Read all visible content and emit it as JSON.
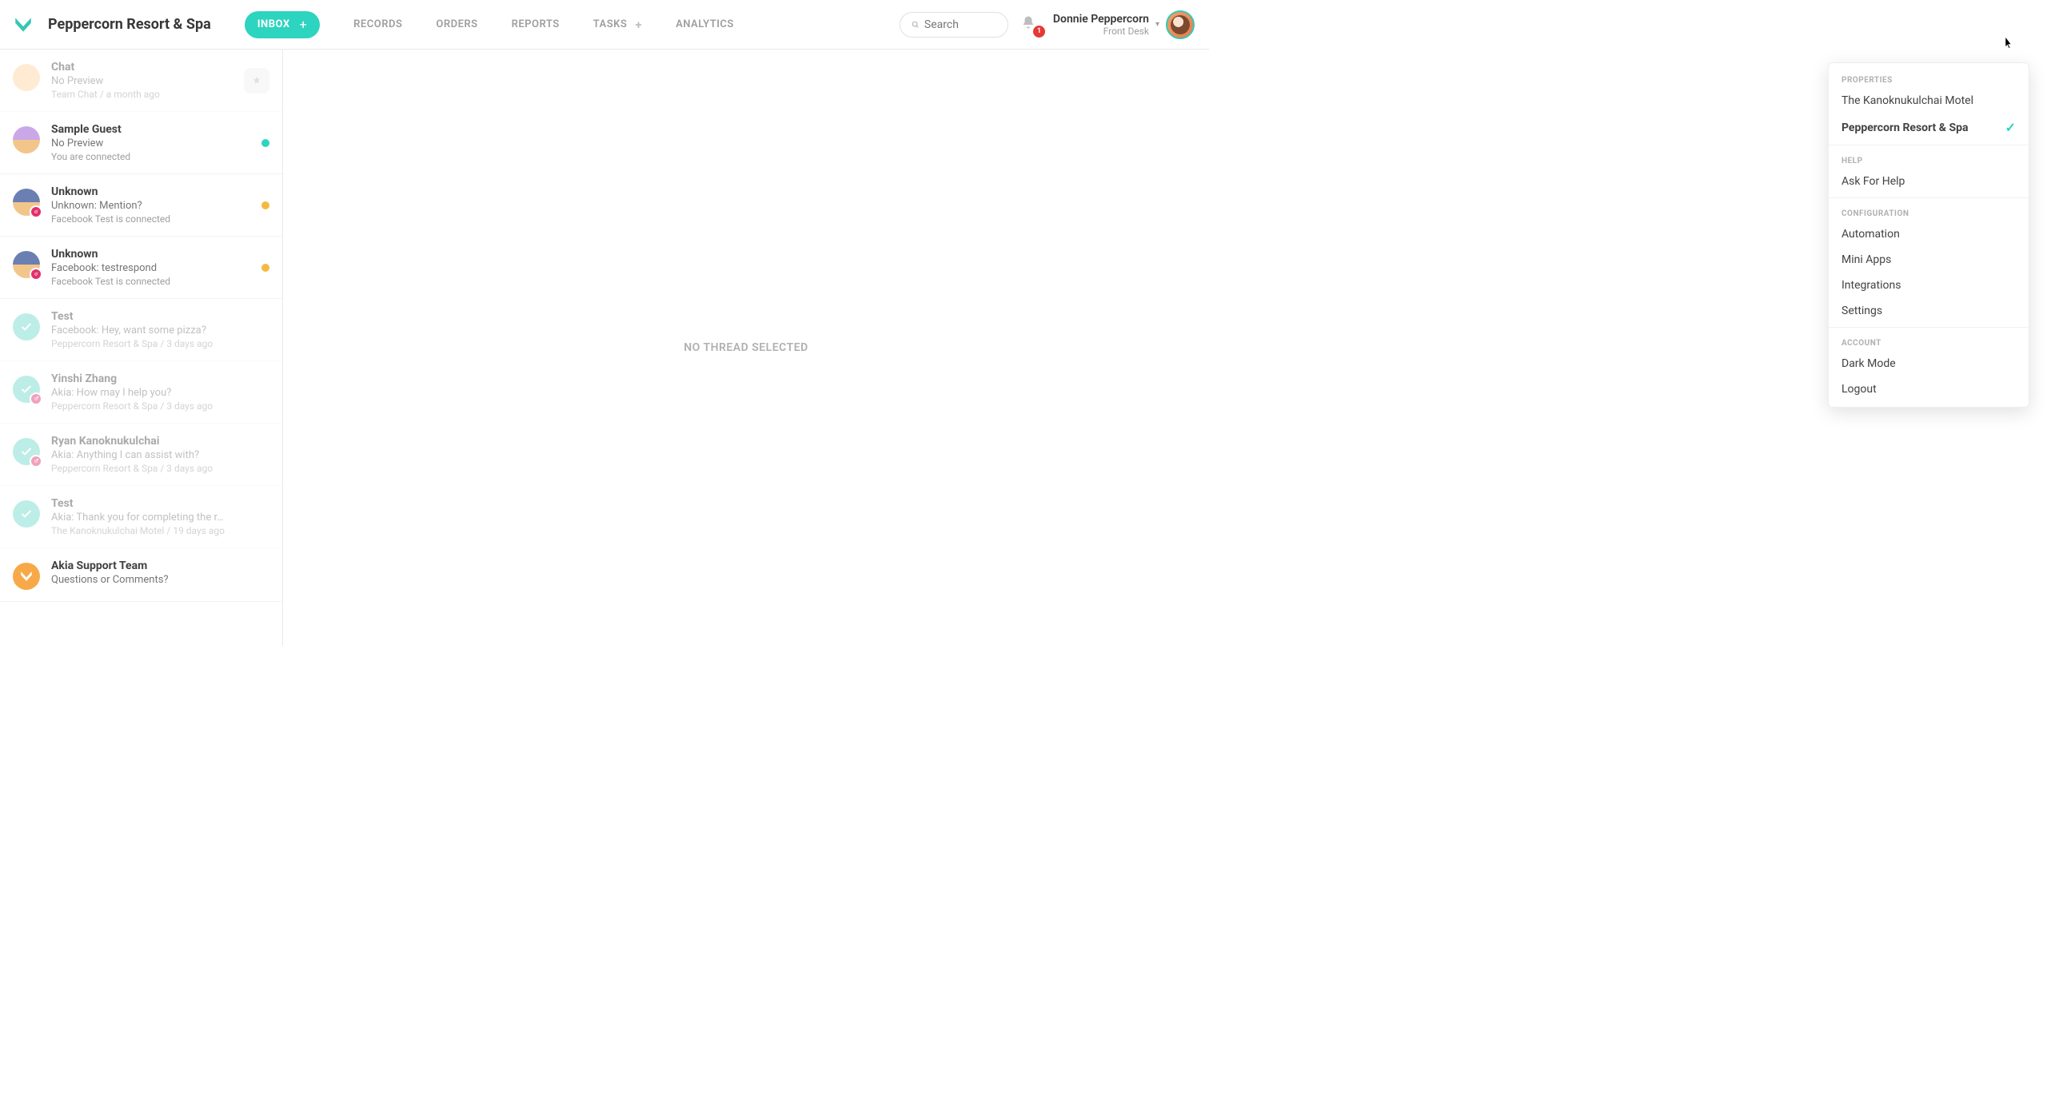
{
  "org_name": "Peppercorn Resort & Spa",
  "nav": {
    "inbox": "INBOX",
    "records": "RECORDS",
    "orders": "ORDERS",
    "reports": "REPORTS",
    "tasks": "TASKS",
    "analytics": "ANALYTICS"
  },
  "search": {
    "placeholder": "Search"
  },
  "notifications": {
    "count": "1"
  },
  "user": {
    "name": "Donnie Peppercorn",
    "role": "Front Desk"
  },
  "threads": [
    {
      "name": "Chat",
      "preview": "No Preview",
      "meta": "Team Chat / a month ago",
      "avatar": "orange",
      "right": "pin",
      "dim": true,
      "sub": null
    },
    {
      "name": "Sample Guest",
      "preview": "No Preview",
      "meta": "You are connected",
      "avatar": "purple",
      "right": "dot-teal",
      "dim": false,
      "sub": null
    },
    {
      "name": "Unknown",
      "preview": "Unknown: Mention?",
      "meta": "Facebook Test is connected",
      "avatar": "dark",
      "right": "dot-amber",
      "dim": false,
      "sub": "ig"
    },
    {
      "name": "Unknown",
      "preview": "Facebook: testrespond",
      "meta": "Facebook Test is connected",
      "avatar": "dark",
      "right": "dot-amber",
      "dim": false,
      "sub": "ig"
    },
    {
      "name": "Test",
      "preview": "Facebook: Hey, want some pizza?",
      "meta": "Peppercorn Resort & Spa / 3 days ago",
      "avatar": "check",
      "right": null,
      "dim": true,
      "sub": null
    },
    {
      "name": "Yinshi Zhang",
      "preview": "Akia: How may I help you?",
      "meta": "Peppercorn Resort & Spa / 3 days ago",
      "avatar": "check",
      "right": null,
      "dim": true,
      "sub": "ig"
    },
    {
      "name": "Ryan Kanoknukulchai",
      "preview": "Akia: Anything I can assist with?",
      "meta": "Peppercorn Resort & Spa / 3 days ago",
      "avatar": "check",
      "right": null,
      "dim": true,
      "sub": "ig"
    },
    {
      "name": "Test",
      "preview": "Akia: Thank you for completing the r…",
      "meta": "The Kanoknukulchai Motel / 19 days ago",
      "avatar": "check",
      "right": null,
      "dim": true,
      "sub": null
    },
    {
      "name": "Akia Support Team",
      "preview": "Questions or Comments?",
      "meta": "",
      "avatar": "logo",
      "right": null,
      "dim": false,
      "sub": null
    }
  ],
  "empty_state": "NO THREAD SELECTED",
  "dropdown": {
    "sections": {
      "properties": "PROPERTIES",
      "help": "HELP",
      "configuration": "CONFIGURATION",
      "account": "ACCOUNT"
    },
    "properties": [
      {
        "label": "The Kanoknukulchai Motel",
        "active": false
      },
      {
        "label": "Peppercorn Resort & Spa",
        "active": true
      }
    ],
    "help": [
      {
        "label": "Ask For Help"
      }
    ],
    "configuration": [
      {
        "label": "Automation"
      },
      {
        "label": "Mini Apps"
      },
      {
        "label": "Integrations"
      },
      {
        "label": "Settings"
      }
    ],
    "account": [
      {
        "label": "Dark Mode"
      },
      {
        "label": "Logout"
      }
    ]
  }
}
